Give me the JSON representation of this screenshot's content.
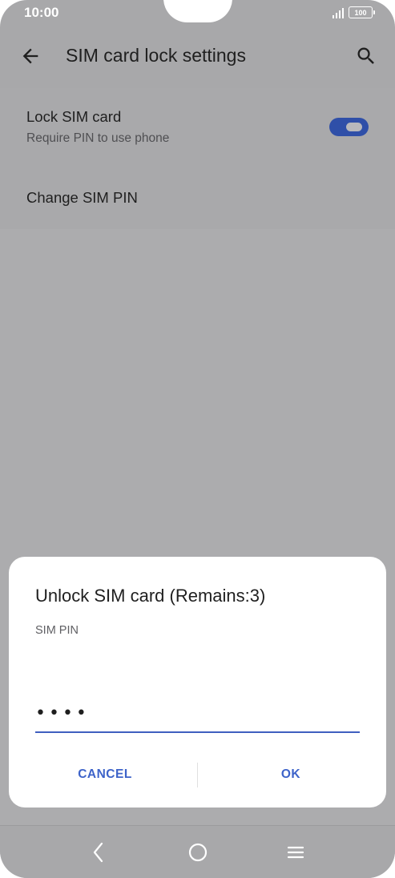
{
  "status_bar": {
    "time": "10:00",
    "battery": "100"
  },
  "app_bar": {
    "title": "SIM card lock settings",
    "back_icon": "arrow-left-icon",
    "search_icon": "search-icon"
  },
  "settings": {
    "lock_sim": {
      "title": "Lock SIM card",
      "subtitle": "Require PIN to use phone",
      "enabled": true
    },
    "change_pin": {
      "title": "Change SIM PIN"
    }
  },
  "dialog": {
    "title": "Unlock SIM card (Remains:3)",
    "field_label": "SIM PIN",
    "pin_value": "••••",
    "cancel_label": "CANCEL",
    "ok_label": "OK"
  },
  "colors": {
    "accent": "#3d63c9",
    "toggle_on": "#2f4fa8",
    "scrim": "#a8a8aa"
  }
}
